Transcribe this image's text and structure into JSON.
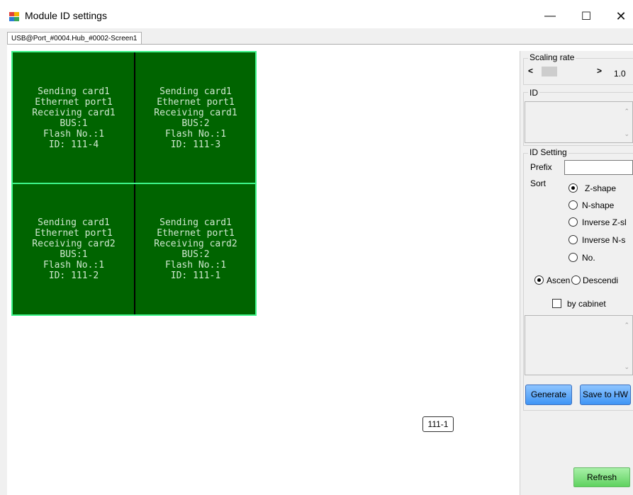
{
  "window": {
    "title": "Module ID settings",
    "minimize_icon": "minimize-icon",
    "maximize_icon": "maximize-icon",
    "close_icon": "close-icon"
  },
  "tab": {
    "label": "USB@Port_#0004.Hub_#0002-Screen1"
  },
  "modules": [
    {
      "lines": [
        "Sending card1",
        "Ethernet port1",
        "Receiving card1",
        "BUS:1",
        "Flash No.:1",
        "ID: 111-4"
      ]
    },
    {
      "lines": [
        "Sending card1",
        "Ethernet port1",
        "Receiving card1",
        "BUS:2",
        "Flash No.:1",
        "ID: 111-3"
      ]
    },
    {
      "lines": [
        "Sending card1",
        "Ethernet port1",
        "Receiving card2",
        "BUS:1",
        "Flash No.:1",
        "ID: 111-2"
      ]
    },
    {
      "lines": [
        "Sending card1",
        "Ethernet port1",
        "Receiving card2",
        "BUS:2",
        "Flash No.:1",
        "ID: 111-1"
      ]
    }
  ],
  "floating_id": "111-1",
  "panel": {
    "scaling_rate": {
      "label": "Scaling rate",
      "value": "1.0"
    },
    "id_group": {
      "label": "ID"
    },
    "id_setting": {
      "label": "ID Setting",
      "prefix_label": "Prefix",
      "prefix_value": "",
      "sort_label": "Sort",
      "sort_options": [
        "Z-shape",
        "N-shape",
        "Inverse Z-sl",
        "Inverse N-s",
        "No."
      ],
      "sort_selected": "Z-shape",
      "order_options": [
        "Ascen",
        "Descendi"
      ],
      "order_selected": "Ascen",
      "by_cabinet_label": "by cabinet",
      "by_cabinet_checked": false,
      "generate_label": "Generate",
      "save_label": "Save to HW"
    },
    "refresh_label": "Refresh"
  }
}
